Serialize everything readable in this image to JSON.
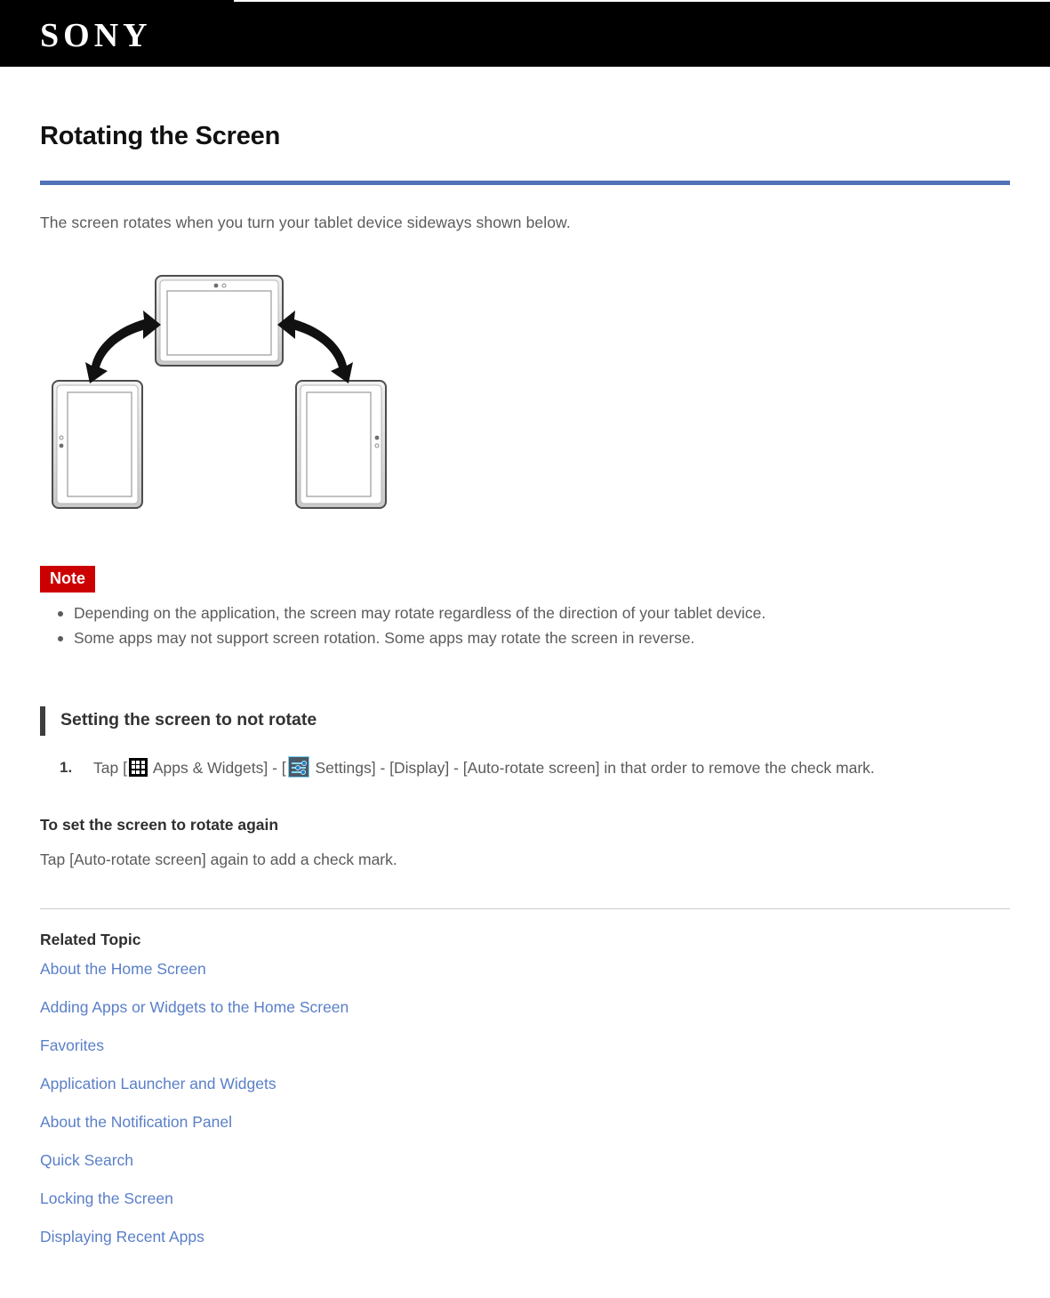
{
  "header": {
    "brand": "SONY",
    "brand_icon": "sony-wordmark"
  },
  "colors": {
    "header_bg": "#000000",
    "title_rule": "#5073b8",
    "note_badge_bg": "#cc0000",
    "link": "#5a7fc8",
    "body_text": "#5b5b5b",
    "heading_bar": "#3d3d3d"
  },
  "article": {
    "title": "Rotating the Screen",
    "intro": "The screen rotates when you turn your tablet device sideways shown below.",
    "figure_alt": "tablet-rotation-diagram"
  },
  "note": {
    "badge": "Note",
    "items": [
      "Depending on the application, the screen may rotate regardless of the direction of your tablet device.",
      "Some apps may not support screen rotation. Some apps may rotate the screen in reverse."
    ]
  },
  "section": {
    "heading": "Setting the screen to not rotate",
    "step1": {
      "prefix": "Tap [",
      "apps_icon_name": "apps-grid-icon",
      "mid1": " Apps & Widgets] - [",
      "settings_icon_name": "settings-sliders-icon",
      "mid2": " Settings] - [Display] - [Auto-rotate screen] in that order to remove the check mark."
    }
  },
  "rotate_again": {
    "heading": "To set the screen to rotate again",
    "body": "Tap [Auto-rotate screen] again to add a check mark."
  },
  "related": {
    "title": "Related Topic",
    "links": [
      "About the Home Screen",
      "Adding Apps or Widgets to the Home Screen",
      "Favorites",
      "Application Launcher and Widgets",
      "About the Notification Panel",
      "Quick Search",
      "Locking the Screen",
      "Displaying Recent Apps"
    ]
  }
}
